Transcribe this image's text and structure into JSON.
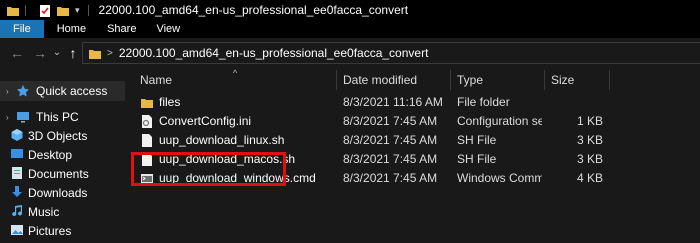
{
  "window": {
    "title": "22000.100_amd64_en-us_professional_ee0facca_convert"
  },
  "ribbon": {
    "tabs": [
      "File",
      "Home",
      "Share",
      "View"
    ]
  },
  "nav": {
    "back": "←",
    "forward": "→",
    "recent": "⌄",
    "up": "↑",
    "address_sep": ">",
    "address": "22000.100_amd64_en-us_professional_ee0facca_convert"
  },
  "sidebar": {
    "items": [
      {
        "label": "Quick access",
        "icon": "star-icon"
      },
      {
        "label": "This PC",
        "icon": "computer-icon"
      },
      {
        "label": "3D Objects",
        "icon": "cube-icon"
      },
      {
        "label": "Desktop",
        "icon": "desktop-icon"
      },
      {
        "label": "Documents",
        "icon": "documents-icon"
      },
      {
        "label": "Downloads",
        "icon": "download-icon"
      },
      {
        "label": "Music",
        "icon": "music-icon"
      },
      {
        "label": "Pictures",
        "icon": "pictures-icon"
      }
    ]
  },
  "columns": {
    "name": "Name",
    "date": "Date modified",
    "type": "Type",
    "size": "Size",
    "sort": "^"
  },
  "files": [
    {
      "name": "files",
      "date": "8/3/2021 11:16 AM",
      "type": "File folder",
      "size": "",
      "icon": "folder-icon"
    },
    {
      "name": "ConvertConfig.ini",
      "date": "8/3/2021 7:45 AM",
      "type": "Configuration setti...",
      "size": "1 KB",
      "icon": "settings-file-icon"
    },
    {
      "name": "uup_download_linux.sh",
      "date": "8/3/2021 7:45 AM",
      "type": "SH File",
      "size": "3 KB",
      "icon": "file-icon"
    },
    {
      "name": "uup_download_macos.sh",
      "date": "8/3/2021 7:45 AM",
      "type": "SH File",
      "size": "3 KB",
      "icon": "file-icon"
    },
    {
      "name": "uup_download_windows.cmd",
      "date": "8/3/2021 7:45 AM",
      "type": "Windows Comma...",
      "size": "4 KB",
      "icon": "cmd-file-icon"
    }
  ],
  "colors": {
    "accent": "#1a73b4",
    "highlight": "#e01010",
    "background": "#191919",
    "folder": "#e8b847"
  }
}
